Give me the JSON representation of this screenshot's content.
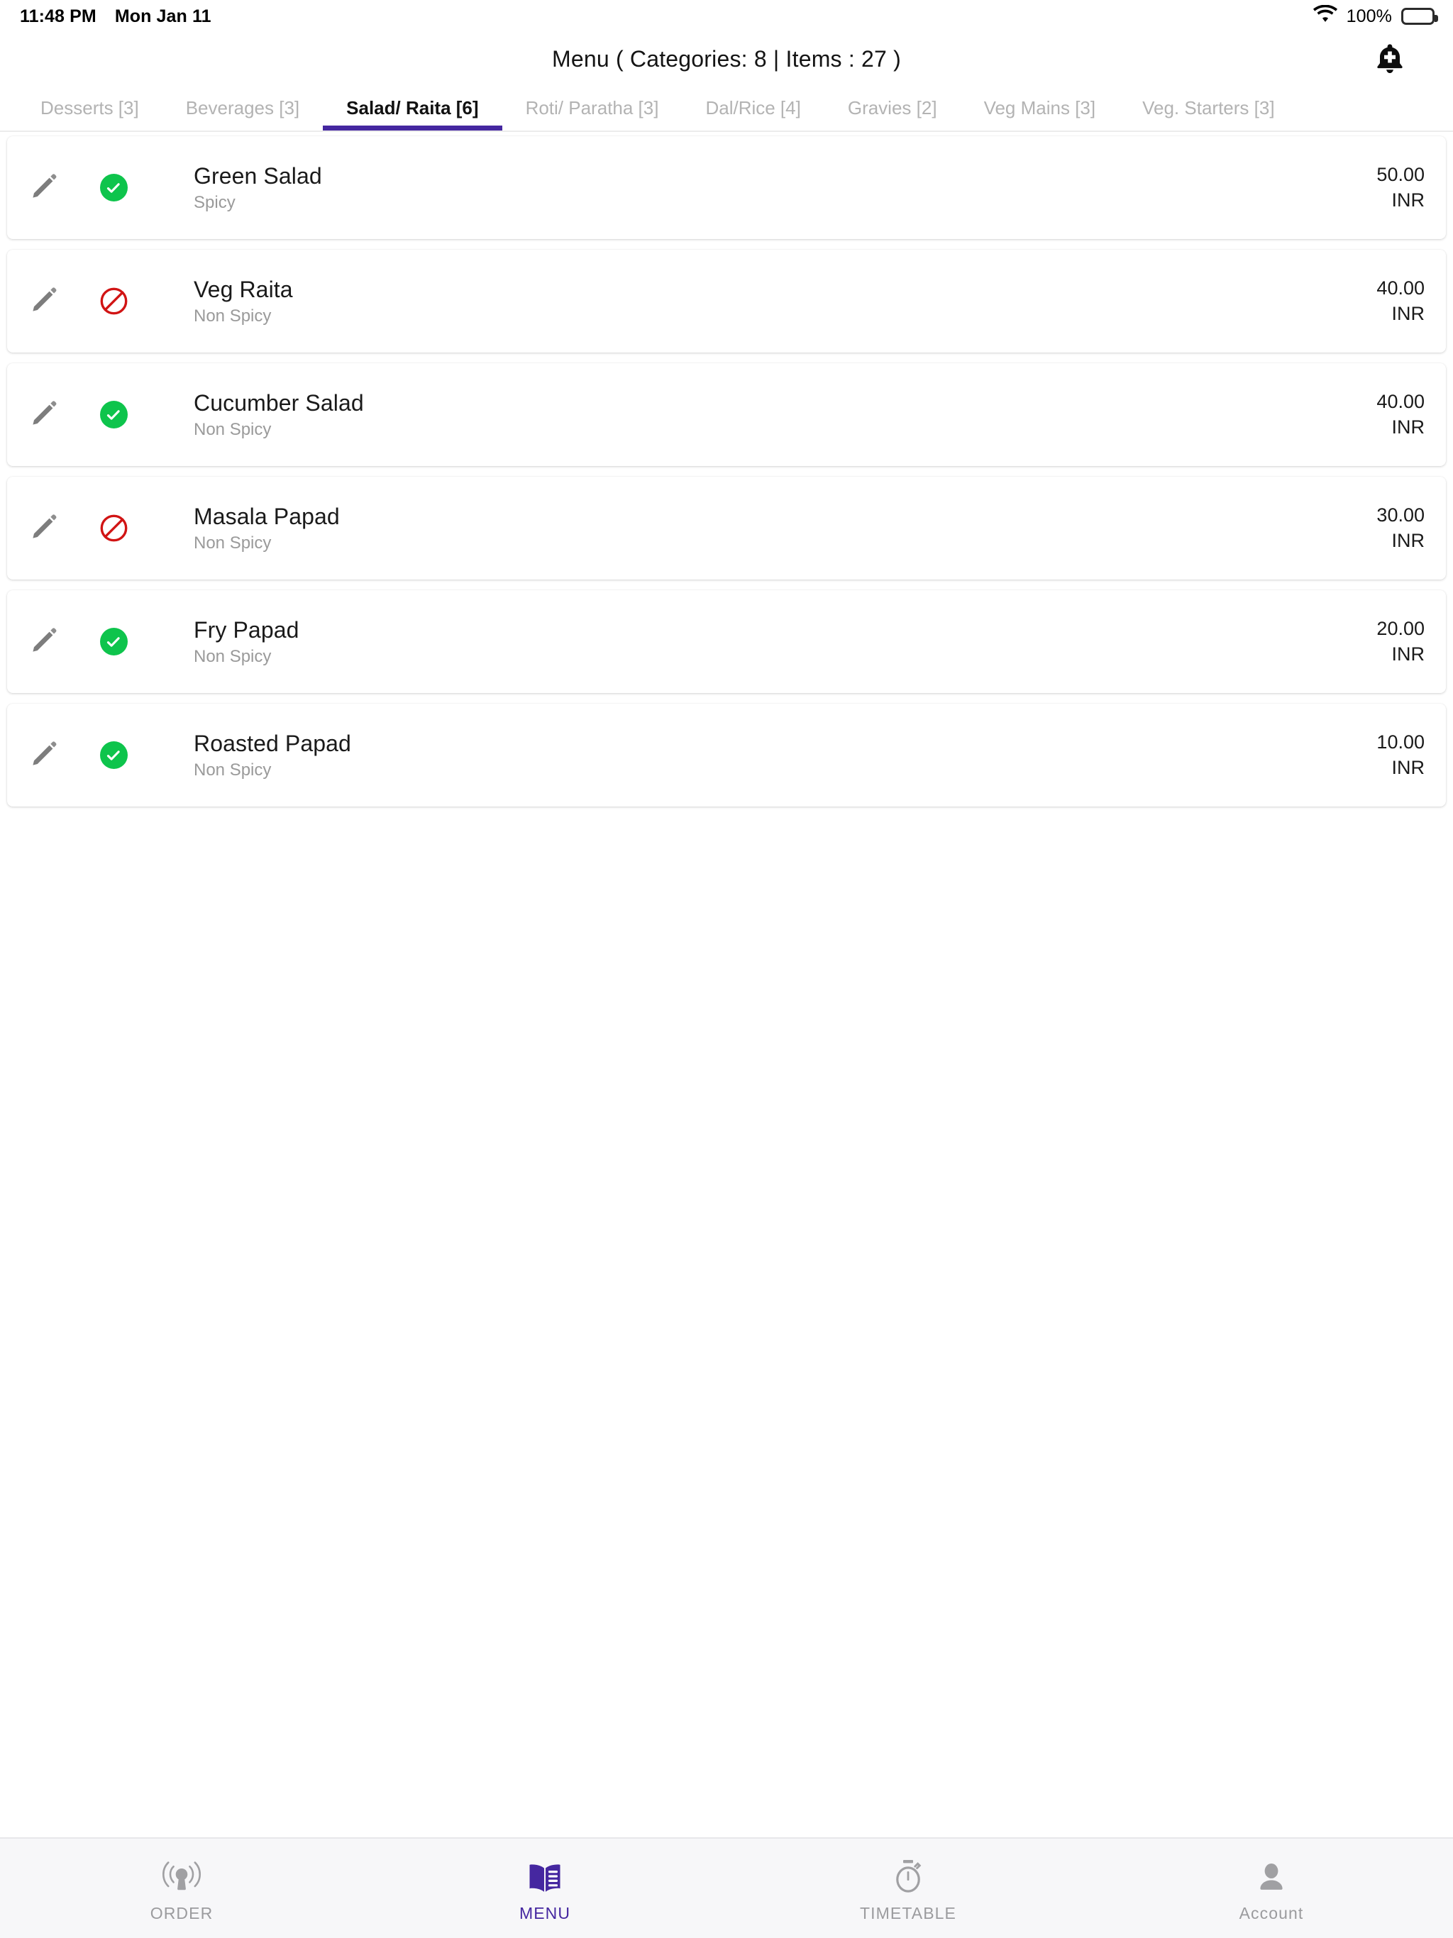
{
  "status_bar": {
    "time": "11:48 PM",
    "date": "Mon Jan 11",
    "battery_percent": "100%",
    "wifi_icon": "wifi-icon",
    "battery_icon": "battery-full-icon"
  },
  "header": {
    "title": "Menu ( Categories: 8 | Items : 27 )",
    "action_icon": "bell-plus-icon"
  },
  "tabs": {
    "active_index": 2,
    "accent_color": "#4527a0",
    "items": [
      {
        "label": "Desserts [3]"
      },
      {
        "label": "Beverages [3]"
      },
      {
        "label": "Salad/ Raita [6]"
      },
      {
        "label": "Roti/ Paratha [3]"
      },
      {
        "label": "Dal/Rice [4]"
      },
      {
        "label": "Gravies [2]"
      },
      {
        "label": "Veg Mains [3]"
      },
      {
        "label": "Veg. Starters [3]"
      }
    ]
  },
  "menu_list": {
    "edit_icon": "pencil-icon",
    "available_icon": "check-circle-icon",
    "unavailable_icon": "block-circle-icon",
    "available_color": "#0ec44c",
    "unavailable_color": "#d11414",
    "rows": [
      {
        "name": "Green Salad",
        "spice": "Spicy",
        "price": "50.00",
        "currency": "INR",
        "status": "available"
      },
      {
        "name": "Veg Raita",
        "spice": "Non Spicy",
        "price": "40.00",
        "currency": "INR",
        "status": "unavailable"
      },
      {
        "name": "Cucumber Salad",
        "spice": "Non Spicy",
        "price": "40.00",
        "currency": "INR",
        "status": "available"
      },
      {
        "name": "Masala Papad",
        "spice": "Non Spicy",
        "price": "30.00",
        "currency": "INR",
        "status": "unavailable"
      },
      {
        "name": "Fry Papad",
        "spice": "Non Spicy",
        "price": "20.00",
        "currency": "INR",
        "status": "available"
      },
      {
        "name": "Roasted Papad",
        "spice": "Non Spicy",
        "price": "10.00",
        "currency": "INR",
        "status": "available"
      }
    ]
  },
  "bottom_nav": {
    "active_index": 1,
    "active_color": "#4527a0",
    "inactive_color": "#9b9b9e",
    "items": [
      {
        "label": "ORDER",
        "icon": "broadcast-icon"
      },
      {
        "label": "MENU",
        "icon": "open-book-icon"
      },
      {
        "label": "TIMETABLE",
        "icon": "stopwatch-icon"
      },
      {
        "label": "Account",
        "icon": "person-icon"
      }
    ]
  }
}
